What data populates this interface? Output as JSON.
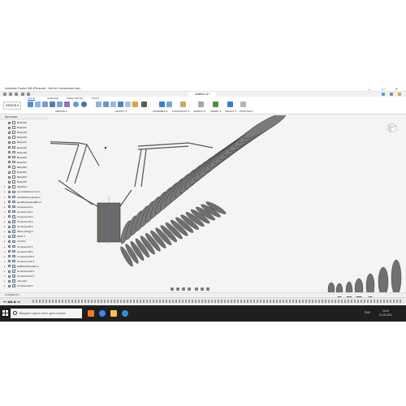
{
  "window": {
    "title": "Autodesk Fusion 360 (Personal - Not for Commercial Use)",
    "controls": "— ☐ ✕",
    "document_tab": "Untitled v1*"
  },
  "ribbon": {
    "workspace": "DESIGN ▾",
    "tabs": [
      {
        "label": "SOLID",
        "active": true
      },
      {
        "label": "SURFACE",
        "active": false
      },
      {
        "label": "SHEET METAL",
        "active": false
      },
      {
        "label": "TOOLS",
        "active": false
      }
    ],
    "groups": [
      "CREATE ▾",
      "MODIFY ▾",
      "ASSEMBLE ▾",
      "CONSTRUCT ▾",
      "INSPECT ▾",
      "INSERT ▾",
      "SELECT ▾",
      "POSITION ▾"
    ]
  },
  "browser": {
    "header": "BROWSER",
    "rows": [
      {
        "label": "Body132",
        "type": "body"
      },
      {
        "label": "Body141",
        "type": "body"
      },
      {
        "label": "Body145",
        "type": "body"
      },
      {
        "label": "Body146",
        "type": "body"
      },
      {
        "label": "Body147",
        "type": "body"
      },
      {
        "label": "Body148",
        "type": "body"
      },
      {
        "label": "Body149",
        "type": "body"
      },
      {
        "label": "Body150",
        "type": "body"
      },
      {
        "label": "Body151",
        "type": "body"
      },
      {
        "label": "Body152",
        "type": "body"
      },
      {
        "label": "Body153",
        "type": "body"
      },
      {
        "label": "Body154",
        "type": "body"
      },
      {
        "label": "Body155",
        "type": "body"
      },
      {
        "label": "Sketches",
        "type": "folder"
      },
      {
        "label": "servoHolder(servo):1",
        "type": "comp"
      },
      {
        "label": "ramka(DecoupledL):1",
        "type": "comp"
      },
      {
        "label": "HardPlanes(keelBar):1",
        "type": "comp"
      },
      {
        "label": "Component1:1",
        "type": "comp"
      },
      {
        "label": "Component2:1",
        "type": "comp"
      },
      {
        "label": "Component3:1",
        "type": "comp"
      },
      {
        "label": "Component4:1",
        "type": "comp"
      },
      {
        "label": "Component5:1",
        "type": "comp"
      },
      {
        "label": "Plane (Wing):1",
        "type": "comp"
      },
      {
        "label": "stator:1",
        "type": "comp"
      },
      {
        "label": "rod.stl:1",
        "type": "comp"
      },
      {
        "label": "Component7:1",
        "type": "comp"
      },
      {
        "label": "Component8:1",
        "type": "comp"
      },
      {
        "label": "Component10:1",
        "type": "comp"
      },
      {
        "label": "Component11:1",
        "type": "comp"
      },
      {
        "label": "HalfPart(shoulder):1",
        "type": "comp"
      },
      {
        "label": "Component12:1",
        "type": "comp"
      },
      {
        "label": "Component13:1",
        "type": "comp"
      },
      {
        "label": "rod.end:1",
        "type": "comp"
      },
      {
        "label": "Component9:1",
        "type": "comp"
      }
    ]
  },
  "comments": {
    "label": "COMMENTS"
  },
  "timeline": {
    "controls": "⏮ ◀ ▶ ▶ ⏭"
  },
  "taskbar": {
    "search_placeholder": "Введите здесь текст для поиска",
    "language": "ENG",
    "time": "11:50",
    "date": "21.06.2021",
    "colors": {
      "fusion": "#f47a20",
      "chrome": "#4285f4",
      "explorer": "#f2c14e",
      "edge": "#2b8fd8"
    }
  },
  "accent": "#0a6ed1"
}
